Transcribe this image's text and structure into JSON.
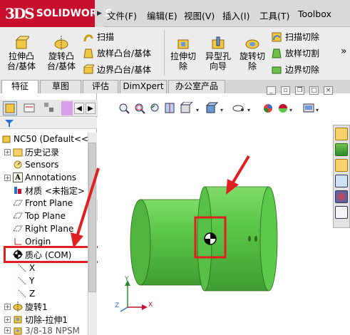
{
  "app": {
    "logo_mark": "3DS",
    "logo_text": "SOLIDWORKS",
    "menus": [
      "文件(F)",
      "编辑(E)",
      "视图(V)",
      "插入(I)",
      "工具(T)",
      "Toolbox"
    ]
  },
  "ribbon": {
    "extrude_boss": [
      "拉伸凸",
      "台/基体"
    ],
    "revolve_boss": [
      "旋转凸",
      "台/基体"
    ],
    "sweep": "扫描",
    "loft_boss": "放样凸台/基体",
    "boundary_boss": "边界凸台/基体",
    "extrude_cut": [
      "拉伸切",
      "除"
    ],
    "hole_wizard": [
      "异型孔",
      "向导"
    ],
    "revolve_cut": [
      "旋转切",
      "除"
    ],
    "swept_cut": "扫描切除",
    "lofted_cut": "放样切割",
    "boundary_cut": "边界切除",
    "more": "»"
  },
  "tabs": [
    "特征",
    "草图",
    "评估",
    "DimXpert",
    "办公室产品"
  ],
  "tree": {
    "part": "NC50 (Default<<",
    "items": [
      {
        "label": "历史记录",
        "icon": "history-folder-icon"
      },
      {
        "label": "Sensors",
        "icon": "sensor-icon"
      },
      {
        "label": "Annotations",
        "icon": "annotations-icon"
      },
      {
        "label": "材质 <未指定>",
        "icon": "material-icon"
      },
      {
        "label": "Front Plane",
        "icon": "plane-icon"
      },
      {
        "label": "Top Plane",
        "icon": "plane-icon"
      },
      {
        "label": "Right Plane",
        "icon": "plane-icon"
      },
      {
        "label": "Origin",
        "icon": "origin-icon"
      },
      {
        "label": "质心 (COM)",
        "icon": "center-of-mass-icon"
      },
      {
        "label": "X",
        "icon": "axis-icon"
      },
      {
        "label": "Y",
        "icon": "axis-icon"
      },
      {
        "label": "Z",
        "icon": "axis-icon"
      },
      {
        "label": "旋转1",
        "icon": "revolve-feature-icon"
      },
      {
        "label": "切除-拉伸1",
        "icon": "cut-extrude-feature-icon"
      },
      {
        "label": "3/8-18 NPSM",
        "icon": "hole-feature-icon"
      }
    ]
  },
  "triad": {
    "x": "X",
    "y": "Y",
    "z": "Z"
  },
  "colors": {
    "brand": "#c8102e",
    "part_green": "#5cc94a",
    "highlight_red": "#e02020",
    "annotation_arrow": "#e02020"
  }
}
